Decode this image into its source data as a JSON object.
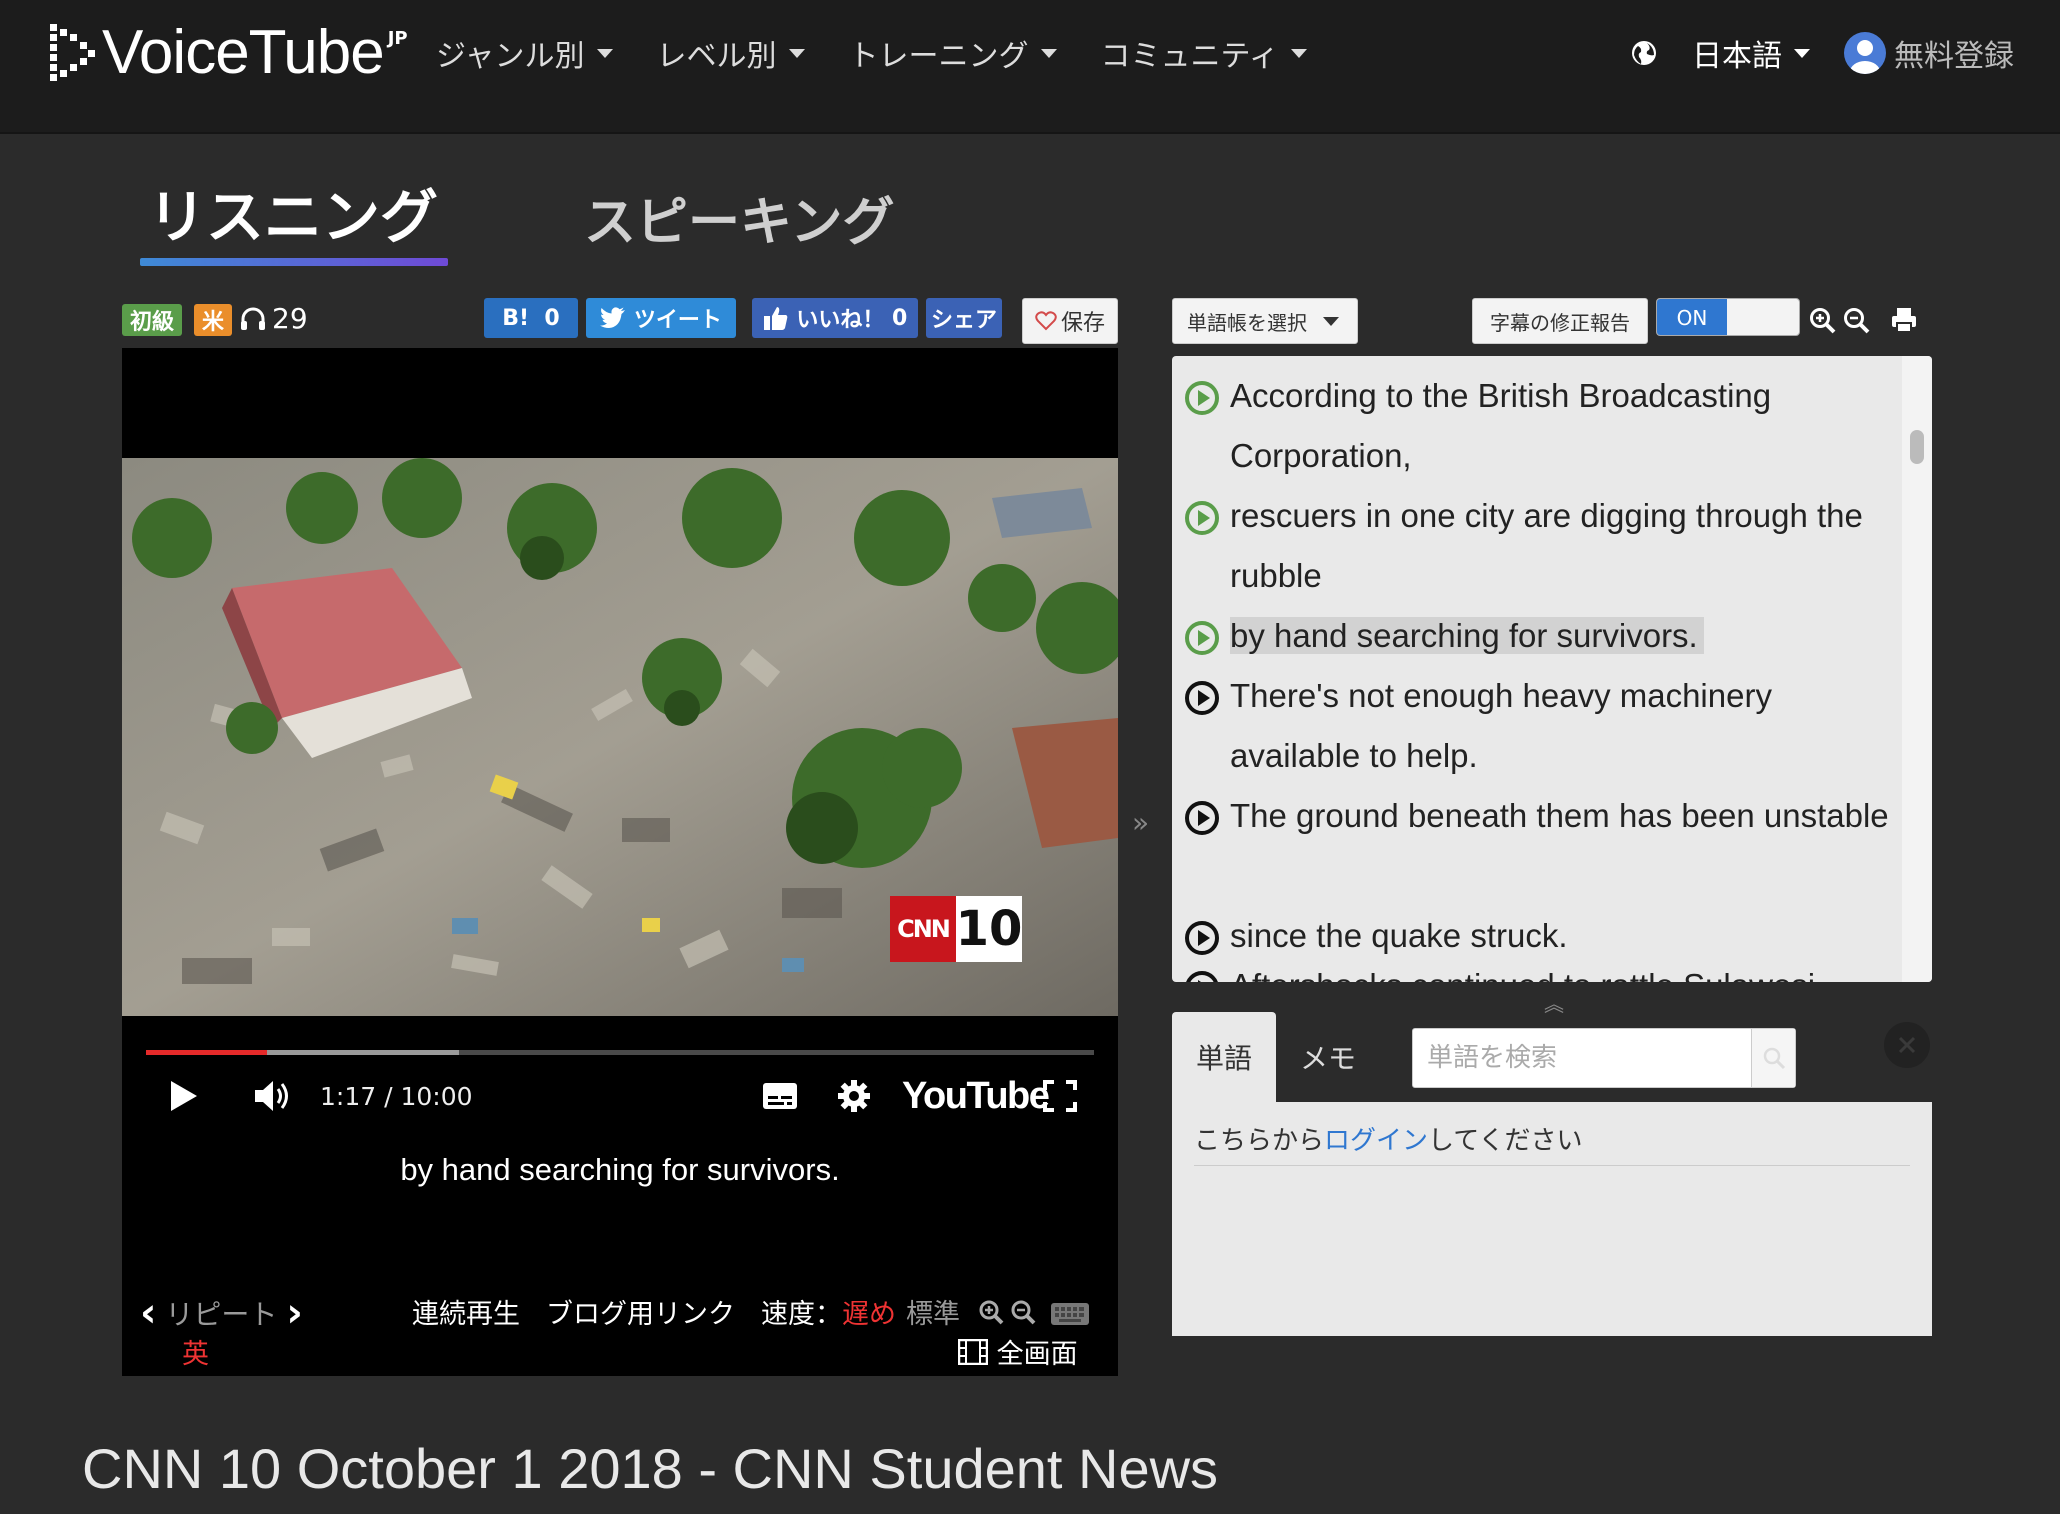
{
  "header": {
    "logo_text": "VoiceTube",
    "logo_sup": "JP",
    "nav": [
      "ジャンル別",
      "レベル別",
      "トレーニング",
      "コミュニティ"
    ],
    "language": "日本語",
    "signup": "無料登録"
  },
  "modes": {
    "listening": "リスニング",
    "speaking": "スピーキング"
  },
  "badges": {
    "level": "初級",
    "accent": "米",
    "listens": "29"
  },
  "share": {
    "hatena_label": "B!",
    "hatena_count": "0",
    "tweet": "ツイート",
    "like": "いいね！",
    "like_count": "0",
    "share": "シェア",
    "save": "保存"
  },
  "player": {
    "time": "1:17 / 10:00",
    "played_fraction": 0.128,
    "buffered_fraction": 0.33,
    "youtube": "YouTube",
    "cnn_text": "CNN",
    "cnn_number": "10",
    "subtitle": "by hand searching for survivors.",
    "repeat": "リピート",
    "subtitle_lang": "英",
    "continuous": "連続再生",
    "blog_link": "ブログ用リンク",
    "speed_label": "速度：",
    "speed_slow": "遅め",
    "speed_normal": "標準",
    "fullscreen": "全画面"
  },
  "right": {
    "vocab_select": "単語帳を選択",
    "report": "字幕の修正報告",
    "toggle": "ON",
    "transcript": [
      {
        "text": "According to the British Broadcasting Corporation,",
        "state": "done"
      },
      {
        "text": "rescuers in one city are digging through the rubble",
        "state": "done"
      },
      {
        "text": "by hand searching for survivors.",
        "state": "current"
      },
      {
        "text": "There's not enough heavy machinery available to help.",
        "state": "next"
      },
      {
        "text": "The ground beneath them has been unstable",
        "state": "next"
      },
      {
        "text": "since the quake struck.",
        "state": "next"
      },
      {
        "text": "Aftershocks continued to rattle Sulawesi",
        "state": "next"
      }
    ],
    "tab_word": "単語",
    "tab_memo": "メモ",
    "search_placeholder": "単語を検索",
    "login_pre": "こちらから",
    "login_link": "ログイン",
    "login_post": "してください"
  },
  "page_title": "CNN 10 October 1 2018 - CNN Student News",
  "colors": {
    "accent_blue": "#2f77d0",
    "played_red": "#e52a2a",
    "active_green": "#5a9d4a"
  }
}
